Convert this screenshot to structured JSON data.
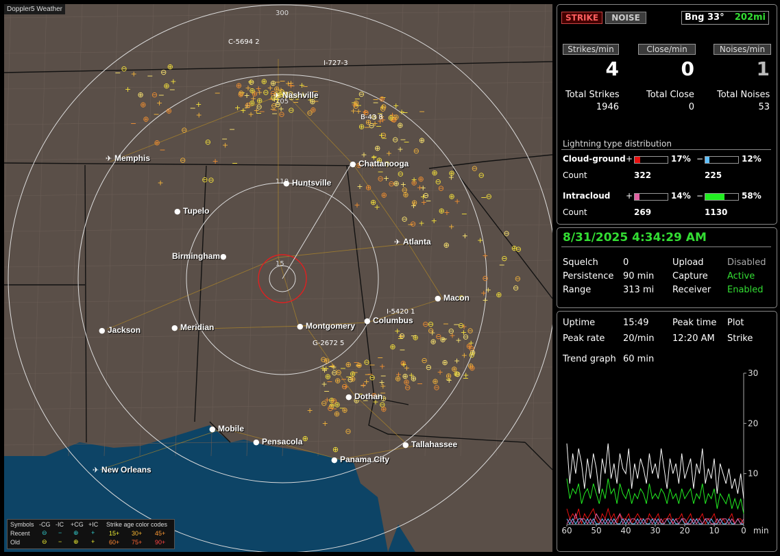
{
  "map": {
    "title": "Doppler5 Weather",
    "ring_labels": [
      "300",
      "205",
      "110",
      "15"
    ],
    "cities": [
      {
        "name": "Nashville",
        "airport": true
      },
      {
        "name": "Memphis",
        "airport": true
      },
      {
        "name": "Chattanooga",
        "airport": false
      },
      {
        "name": "Huntsville",
        "airport": false
      },
      {
        "name": "Tupelo",
        "airport": false
      },
      {
        "name": "Atlanta",
        "airport": true
      },
      {
        "name": "Birmingham",
        "airport": false
      },
      {
        "name": "Macon",
        "airport": false
      },
      {
        "name": "Jackson",
        "airport": false
      },
      {
        "name": "Meridian",
        "airport": false
      },
      {
        "name": "Montgomery",
        "airport": false
      },
      {
        "name": "Columbus",
        "airport": false
      },
      {
        "name": "Dothan",
        "airport": false
      },
      {
        "name": "Mobile",
        "airport": false
      },
      {
        "name": "Pensacola",
        "airport": false
      },
      {
        "name": "Tallahassee",
        "airport": false
      },
      {
        "name": "Panama City",
        "airport": false
      },
      {
        "name": "New Orleans",
        "airport": true
      }
    ],
    "cell_labels": [
      "C-5694 2",
      "I-727-3",
      "B-43 8",
      "I-5420 1",
      "G-2672 5"
    ],
    "legend": {
      "symbols": "Symbols",
      "headers": [
        "-CG",
        "-IC",
        "+CG",
        "+IC"
      ],
      "rows": [
        "Recent",
        "Old"
      ],
      "age_title": "Strike age color codes",
      "ages_recent": [
        "15+",
        "30+",
        "45+"
      ],
      "ages_old": [
        "60+",
        "75+",
        "90+"
      ]
    }
  },
  "top": {
    "strike_button": "STRIKE",
    "noise_button": "NOISE",
    "bearing_label": "Bng 33°",
    "distance": "202mi"
  },
  "rates": {
    "strikes_label": "Strikes/min",
    "strikes_value": "4",
    "close_label": "Close/min",
    "close_value": "0",
    "noises_label": "Noises/min",
    "noises_value": "1"
  },
  "totals": {
    "strikes_label": "Total Strikes",
    "strikes_value": "1946",
    "close_label": "Total Close",
    "close_value": "0",
    "noises_label": "Total Noises",
    "noises_value": "53"
  },
  "distribution": {
    "title": "Lightning type distribution",
    "cg_label": "Cloud-ground",
    "ic_label": "Intracloud",
    "count_label": "Count",
    "plus": "+",
    "minus": "−",
    "cg_pos_pct": "17%",
    "cg_neg_pct": "12%",
    "cg_pos_count": "322",
    "cg_neg_count": "225",
    "ic_pos_pct": "14%",
    "ic_neg_pct": "58%",
    "ic_pos_count": "269",
    "ic_neg_count": "1130",
    "cg_pos_frac": 0.17,
    "cg_neg_frac": 0.12,
    "ic_pos_frac": 0.14,
    "ic_neg_frac": 0.58,
    "colors": {
      "cg_pos": "#e81010",
      "cg_neg": "#60c0ff",
      "ic_pos": "#e060a0",
      "ic_neg": "#22ee22"
    }
  },
  "status": {
    "datetime": "8/31/2025 4:34:29 AM",
    "squelch_label": "Squelch",
    "squelch_value": "0",
    "persistence_label": "Persistence",
    "persistence_value": "90 min",
    "range_label": "Range",
    "range_value": "313 mi",
    "upload_label": "Upload",
    "upload_value": "Disabled",
    "capture_label": "Capture",
    "capture_value": "Active",
    "receiver_label": "Receiver",
    "receiver_value": "Enabled"
  },
  "stats": {
    "uptime_label": "Uptime",
    "uptime_value": "15:49",
    "peak_time_label": "Peak time",
    "plot_label": "Plot",
    "peak_rate_label": "Peak rate",
    "peak_rate_value": "20/min",
    "peak_time_value": "12:20 AM",
    "plot_value": "Strike",
    "trend_label": "Trend graph",
    "trend_value": "60 min"
  },
  "chart_data": {
    "type": "line",
    "x_ticks": [
      "60",
      "50",
      "40",
      "30",
      "20",
      "10",
      "0"
    ],
    "x_unit": "min",
    "y_ticks": [
      "30",
      "20",
      "10"
    ],
    "ylim": [
      0,
      30
    ],
    "xlim": [
      60,
      0
    ],
    "series": [
      {
        "color": "#ffffff",
        "values": [
          16,
          8,
          14,
          10,
          15,
          12,
          7,
          13,
          9,
          14,
          11,
          6,
          13,
          10,
          16,
          9,
          12,
          8,
          14,
          11,
          10,
          15,
          7,
          12,
          9,
          13,
          11,
          8,
          14,
          10,
          12,
          9,
          15,
          11,
          7,
          13,
          10,
          12,
          8,
          14,
          9,
          11,
          13,
          7,
          12,
          10,
          15,
          8,
          11,
          9,
          13,
          6,
          12,
          10,
          8,
          11,
          7,
          9,
          6,
          10,
          5
        ]
      },
      {
        "color": "#22ee22",
        "values": [
          9,
          5,
          7,
          6,
          8,
          4,
          6,
          7,
          5,
          8,
          6,
          4,
          7,
          5,
          9,
          6,
          7,
          4,
          8,
          6,
          5,
          7,
          4,
          6,
          5,
          7,
          6,
          4,
          8,
          5,
          6,
          5,
          7,
          6,
          4,
          7,
          5,
          6,
          4,
          7,
          5,
          6,
          7,
          4,
          6,
          5,
          8,
          4,
          6,
          5,
          7,
          3,
          6,
          5,
          4,
          6,
          3,
          5,
          3,
          5,
          2
        ]
      },
      {
        "color": "#e81010",
        "values": [
          3,
          1,
          2,
          1,
          3,
          0,
          2,
          1,
          2,
          3,
          1,
          0,
          2,
          1,
          3,
          1,
          2,
          0,
          2,
          1,
          1,
          2,
          0,
          1,
          2,
          1,
          1,
          0,
          2,
          1,
          1,
          2,
          0,
          1,
          1,
          2,
          0,
          1,
          1,
          2,
          0,
          1,
          2,
          0,
          1,
          1,
          2,
          0,
          1,
          1,
          2,
          0,
          1,
          1,
          0,
          1,
          2,
          0,
          1,
          1,
          0
        ]
      },
      {
        "color": "#60c0ff",
        "values": [
          1,
          0,
          1,
          0,
          1,
          1,
          0,
          1,
          0,
          1,
          0,
          0,
          1,
          0,
          1,
          0,
          1,
          0,
          0,
          1,
          0,
          1,
          0,
          0,
          1,
          0,
          1,
          0,
          0,
          1,
          0,
          1,
          0,
          0,
          1,
          0,
          1,
          0,
          0,
          1,
          0,
          0,
          1,
          0,
          1,
          0,
          0,
          1,
          0,
          1,
          0,
          0,
          1,
          0,
          0,
          1,
          0,
          0,
          1,
          0,
          0
        ]
      },
      {
        "color": "#e060a0",
        "values": [
          0,
          1,
          0,
          2,
          0,
          1,
          1,
          0,
          1,
          0,
          2,
          1,
          0,
          1,
          0,
          1,
          0,
          1,
          2,
          0,
          1,
          0,
          1,
          1,
          0,
          1,
          0,
          1,
          1,
          0,
          1,
          0,
          1,
          0,
          1,
          1,
          0,
          1,
          0,
          1,
          1,
          0,
          0,
          1,
          0,
          1,
          0,
          1,
          1,
          0,
          0,
          1,
          0,
          1,
          1,
          0,
          1,
          0,
          1,
          0,
          1
        ]
      }
    ]
  }
}
